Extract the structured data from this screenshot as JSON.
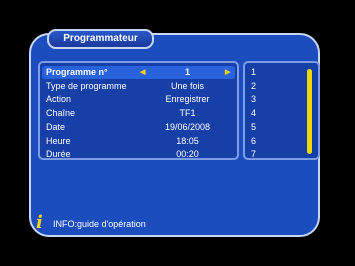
{
  "window": {
    "title": "Programmateur"
  },
  "form": {
    "rows": [
      {
        "label": "Programme n°",
        "value": "1"
      },
      {
        "label": "Type de programme",
        "value": "Une fois"
      },
      {
        "label": "Action",
        "value": "Enregistrer"
      },
      {
        "label": "Chaîne",
        "value": "TF1"
      },
      {
        "label": "Date",
        "value": "19/06/2008"
      },
      {
        "label": "Heure",
        "value": "18:05"
      },
      {
        "label": "Durée",
        "value": "00:20"
      }
    ]
  },
  "list": {
    "numbers": [
      "1",
      "2",
      "3",
      "4",
      "5",
      "6",
      "7"
    ]
  },
  "info": {
    "text": "INFO:guide d'opération",
    "icon": "info-icon"
  },
  "colors": {
    "panel_blue": "#1b4dbf",
    "highlight_blue": "#2863dd",
    "accent_yellow": "#f2d70b"
  }
}
